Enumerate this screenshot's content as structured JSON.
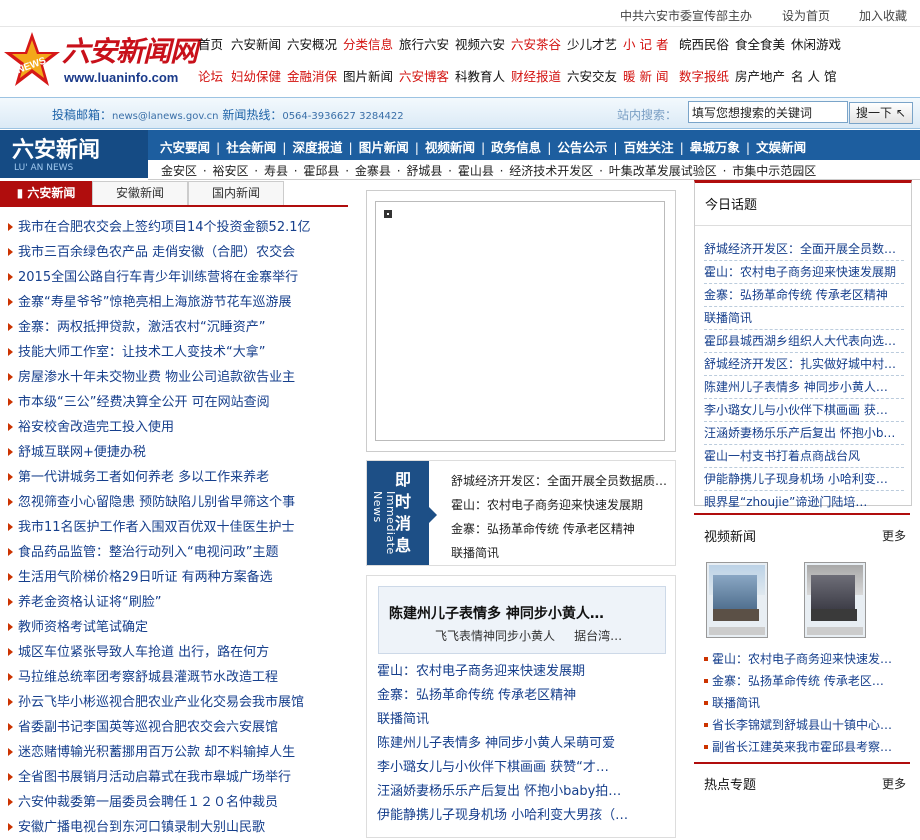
{
  "topline": {
    "sponsor": "中共六安市委宣传部主办",
    "set_home": "设为首页",
    "add_fav": "加入收藏"
  },
  "logo": {
    "title": "六安新闻网",
    "url": "www.luaninfo.com"
  },
  "nav_row1": [
    "首页",
    "六安新闻",
    "六安概况",
    "分类信息",
    "旅行六安",
    "视频六安",
    "六安茶谷",
    "少儿才艺",
    "小 记 者",
    "皖西民俗",
    "食全食美",
    "休闲游戏"
  ],
  "nav_row1_red": [
    false,
    false,
    false,
    true,
    false,
    false,
    true,
    false,
    true,
    false,
    false,
    false
  ],
  "nav_row2": [
    "论坛",
    "妇幼保健",
    "金融消保",
    "图片新闻",
    "六安博客",
    "科教育人",
    "财经报道",
    "六安交友",
    "暖 新 闻",
    "数字报纸",
    "房产地产",
    "名 人 馆"
  ],
  "nav_row2_red": [
    true,
    true,
    true,
    false,
    true,
    false,
    true,
    false,
    true,
    true,
    false,
    false
  ],
  "searchbar": {
    "mail_label": "投稿邮箱：",
    "mail": "news@lanews.gov.cn",
    "hotline_label": "新闻热线：",
    "hotline": "0564-3936627 3284422",
    "search_label": "站内搜索：",
    "placeholder": "填写您想搜索的关键词",
    "button": "搜一下"
  },
  "brand": {
    "title": "六安新闻",
    "en": "LU' AN NEWS"
  },
  "channels": [
    "六安要闻",
    "社会新闻",
    "深度报道",
    "图片新闻",
    "视频新闻",
    "政务信息",
    "公告公示",
    "百姓关注",
    "皋城万象",
    "文娱新闻"
  ],
  "districts": [
    "金安区",
    "裕安区",
    "寿县",
    "霍邱县",
    "金寨县",
    "舒城县",
    "霍山县",
    "经济技术开发区",
    "叶集改革发展试验区",
    "市集中示范园区"
  ],
  "tabs": [
    "六安新闻",
    "安徽新闻",
    "国内新闻"
  ],
  "news": [
    "我市在合肥农交会上签约项目14个投资金额52.1亿",
    "我市三百余绿色农产品 走俏安徽（合肥）农交会",
    "2015全国公路自行车青少年训练营将在金寨举行",
    "金寨“寿星爷爷”惊艳亮相上海旅游节花车巡游展",
    "金寨：两权抵押贷款，激活农村“沉睡资产”",
    "技能大师工作室：让技术工人变技术“大拿”",
    "房屋渗水十年未交物业费 物业公司追款欲告业主",
    "市本级“三公”经费决算全公开 可在网站查阅",
    "裕安校舍改造完工投入使用",
    "舒城互联网+便捷办税",
    "第一代讲城务工者如何养老 多以工作来养老",
    "忽视筛查小心留隐患 预防缺陷儿别省早筛这个事",
    "我市11名医护工作者入围双百优双十佳医生护士",
    "食品药品监管：整治行动列入“电视问政”主题",
    "生活用气阶梯价格29日听证 有两种方案备选",
    "养老金资格认证将“刷脸”",
    "教师资格考试笔试确定",
    "城区车位紧张导致人车抢道 出行，路在何方",
    "马拉维总统率团考察舒城县灌溉节水改造工程",
    "孙云飞毕小彬巡视合肥农业产业化交易会我市展馆",
    "省委副书记李国英等巡视合肥农交会六安展馆",
    "迷恋赌博输光积蓄挪用百万公款 却不料输掉人生",
    "全省图书展销月活动启幕式在我市皋城广场举行",
    "六安仲裁委第一届委员会聘任１２０名仲裁员",
    "安徽广播电视台到东河口镇录制大别山民歌"
  ],
  "instant": {
    "title": "即时消息",
    "en": "Immediate News",
    "items": [
      "舒城经济开发区：全面开展全员数据质…",
      "霍山：农村电子商务迎来快速发展期",
      "金寨：弘扬革命传统 传承老区精神",
      "联播简讯"
    ]
  },
  "feature": {
    "headline": "陈建州儿子表情多 神同步小黄人…",
    "sub": "飞飞表情神同步小黄人",
    "sub2": "据台湾…",
    "items": [
      "霍山：农村电子商务迎来快速发展期",
      "金寨：弘扬革命传统 传承老区精神",
      "联播简讯",
      "陈建州儿子表情多 神同步小黄人呆萌可爱",
      "李小璐女儿与小伙伴下棋画画 获赞“才…",
      "汪涵娇妻杨乐乐产后复出 怀抱小baby拍…",
      "伊能静携儿子现身机场 小哈利变大男孩（…"
    ]
  },
  "today": {
    "title": "今日话题",
    "items": [
      "舒城经济开发区：全面开展全员数…",
      "霍山：农村电子商务迎来快速发展期",
      "金寨：弘扬革命传统 传承老区精神",
      "联播简讯",
      "霍邱县城西湖乡组织人大代表向选…",
      "舒城经济开发区：扎实做好城中村…",
      "陈建州儿子表情多 神同步小黄人…",
      "李小璐女儿与小伙伴下棋画画 获…",
      "汪涵娇妻杨乐乐产后复出 怀抱小b…",
      "霍山一村支书打着点商战台风",
      "伊能静携儿子现身机场 小哈利变…",
      "眼界星“zhoujie”谛逊门陆培…"
    ]
  },
  "video": {
    "title": "视频新闻",
    "more": "更多",
    "items": [
      "霍山：农村电子商务迎来快速发…",
      "金寨：弘扬革命传统 传承老区…",
      "联播简讯",
      "省长李锦斌到舒城县山十镇中心…",
      "副省长江建英来我市霍邱县考察…"
    ]
  },
  "hot": {
    "title": "热点专题",
    "more": "更多"
  }
}
